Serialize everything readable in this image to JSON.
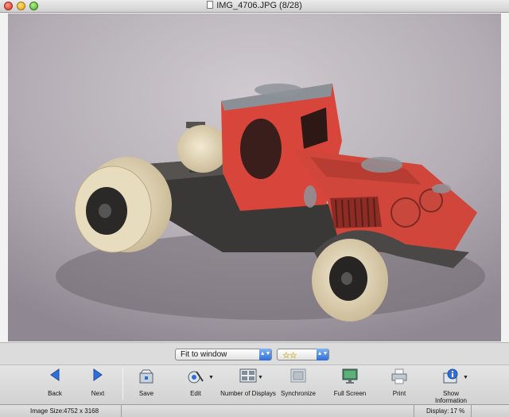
{
  "window": {
    "title": "IMG_4706.JPG (8/28)"
  },
  "controls": {
    "fit_select": "Fit to window",
    "rating_stars": "☆☆"
  },
  "toolbar": {
    "back": "Back",
    "next": "Next",
    "save": "Save",
    "edit": "Edit",
    "number_of_displays": "Number of Displays",
    "synchronize": "Synchronize",
    "full_screen": "Full Screen",
    "print": "Print",
    "show_information_line1": "Show",
    "show_information_line2": "Information"
  },
  "status": {
    "image_size_label": "Image Size:",
    "image_size_value": "4752 x 3168",
    "display_label": "Display:",
    "display_value": "17 %"
  },
  "colors": {
    "accent_blue": "#2f6fd6",
    "truck_red": "#d8453a",
    "star_yellow": "#e8c200"
  }
}
